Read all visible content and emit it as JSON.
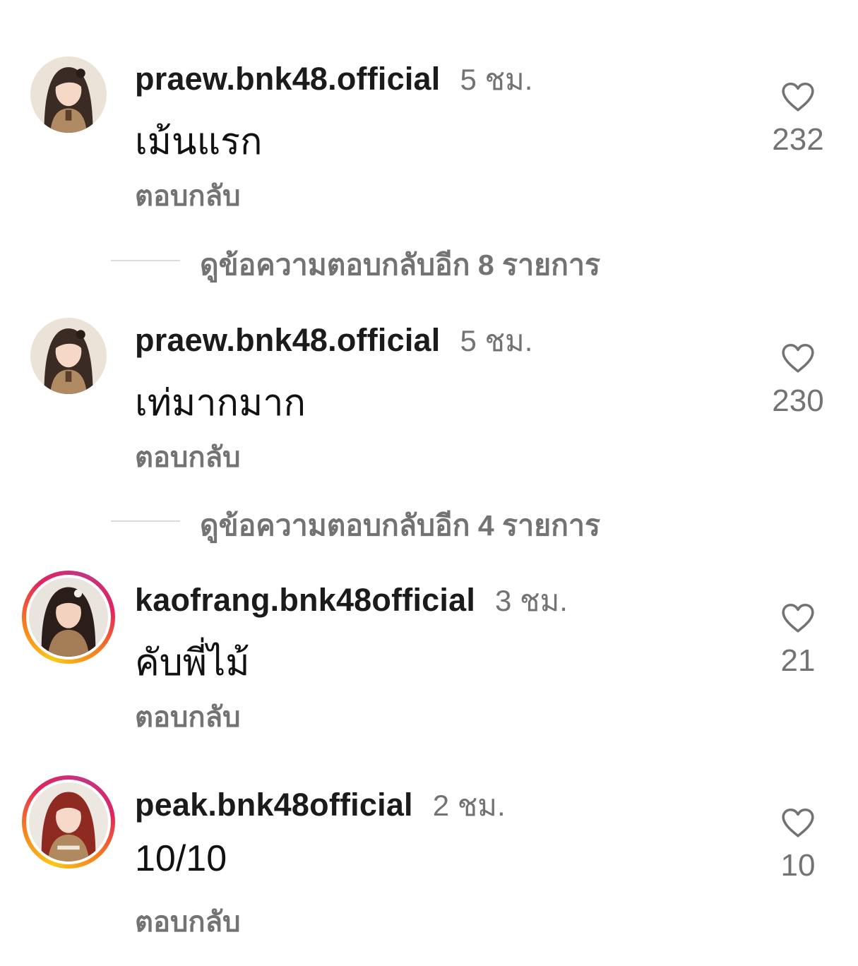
{
  "comments": [
    {
      "username": "praew.bnk48.official",
      "time": "5 ชม.",
      "text": "เม้นแรก",
      "reply_label": "ตอบกลับ",
      "likes": "232",
      "story_ring": false
    },
    {
      "username": "praew.bnk48.official",
      "time": "5 ชม.",
      "text": "เท่มากมาก",
      "reply_label": "ตอบกลับ",
      "likes": "230",
      "story_ring": false
    },
    {
      "username": "kaofrang.bnk48official",
      "time": "3 ชม.",
      "text": "คับพี่ไม้",
      "reply_label": "ตอบกลับ",
      "likes": "21",
      "story_ring": true
    },
    {
      "username": "peak.bnk48official",
      "time": "2 ชม.",
      "text": "10/10",
      "reply_label": "ตอบกลับ",
      "likes": "10",
      "story_ring": true
    }
  ],
  "view_replies": [
    {
      "label": "ดูข้อความตอบกลับอีก 8 รายการ"
    },
    {
      "label": "ดูข้อความตอบกลับอีก 4 รายการ"
    }
  ],
  "icons": {
    "like": "heart-icon"
  },
  "colors": {
    "secondary_text": "#737373",
    "divider": "#dbdbdb",
    "story_ring_start": "#f9c81a",
    "story_ring_mid": "#e0245e",
    "story_ring_end": "#c13584"
  }
}
